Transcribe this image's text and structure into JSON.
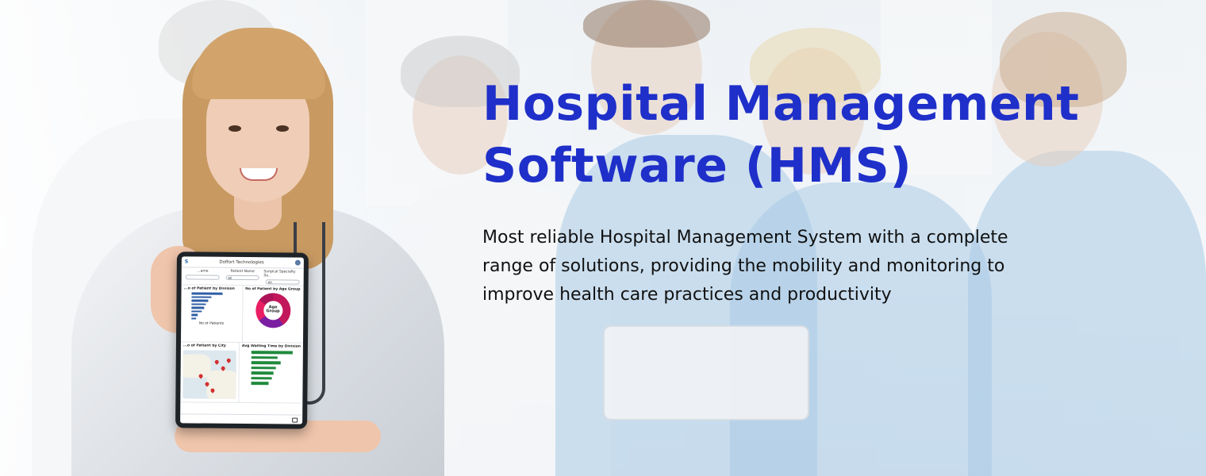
{
  "hero": {
    "title_line1": "Hospital Management",
    "title_line2": "Software (HMS)",
    "description_line1": "Most reliable Hospital Management System with a complete",
    "description_line2": "range of solutions, providing the mobility and  monitoring to",
    "description_line3": "improve health care practices and productivity"
  },
  "tablet": {
    "company": "Doffort Technologies",
    "brand_letter": "S",
    "filters": [
      {
        "label": "...ame",
        "value": ""
      },
      {
        "label": "Patient Name",
        "value": "All"
      },
      {
        "label": "Surgical Specialty Su..",
        "value": "All"
      }
    ],
    "panels": {
      "division_title": "...o of Patient by Division",
      "division_axis": "No of Patients",
      "age_title": "No of Patient by Age Group",
      "age_center": "Age Group",
      "city_title": "...o of Patient by City",
      "waiting_title": "Avg Waiting Time by Division"
    }
  },
  "colors": {
    "title": "#1f2fc9",
    "text": "#111111",
    "chart_bar_blue": "#2f5fa5",
    "chart_bar_green": "#1f8a3c",
    "donut_magenta": "#c2185b"
  }
}
